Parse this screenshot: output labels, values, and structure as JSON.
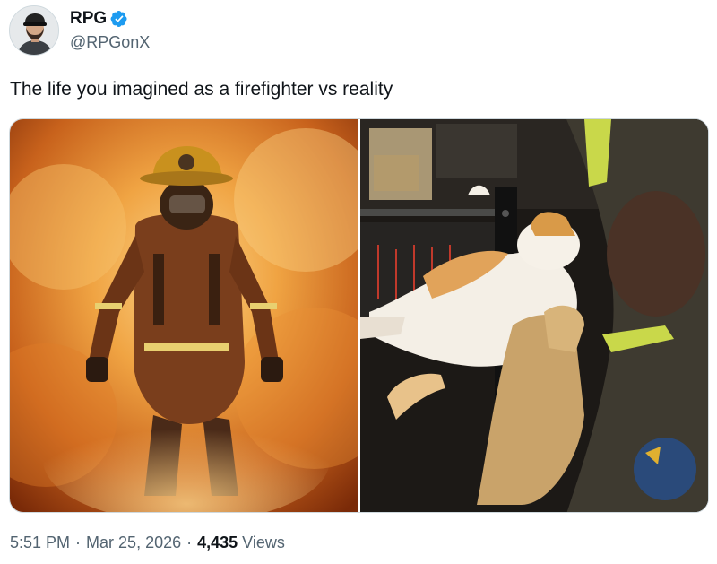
{
  "author": {
    "display_name": "RPG",
    "handle": "@RPGonX",
    "verified_icon": "verified-badge-icon",
    "badge_color": "#1d9bf0"
  },
  "tweet": {
    "text": "The life you imagined as a firefighter vs reality"
  },
  "media": {
    "images": [
      {
        "icon": "firefighter-in-flames-photo"
      },
      {
        "icon": "firefighter-holding-cat-photo"
      }
    ]
  },
  "meta": {
    "time": "5:51 PM",
    "separator": "·",
    "date": "Mar 25, 2026",
    "views_count": "4,435",
    "views_label": "Views"
  }
}
